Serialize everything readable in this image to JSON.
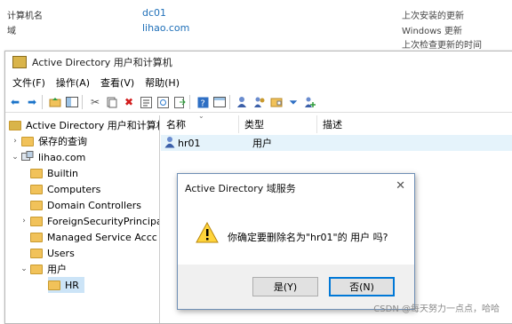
{
  "server_info": {
    "computer_name_label": "计算机名",
    "computer_name_value": "dc01",
    "domain_label": "域",
    "domain_value": "lihao.com",
    "right_line1": "上次安装的更新",
    "right_line2": "Windows 更新",
    "right_line3": "上次检查更新的时间"
  },
  "window": {
    "title": "Active Directory 用户和计算机"
  },
  "menu": [
    "文件(F)",
    "操作(A)",
    "查看(V)",
    "帮助(H)"
  ],
  "toolbar_icons": [
    "back-icon",
    "forward-icon",
    "up-icon",
    "show-tree-icon",
    "cut-icon",
    "copy-icon",
    "delete-icon",
    "properties-icon",
    "refresh-icon",
    "export-icon",
    "help-icon",
    "console-icon",
    "add-user-icon",
    "add-group-icon",
    "add-ou-icon",
    "filter-icon",
    "add-to-group-icon"
  ],
  "tree": {
    "root": "Active Directory 用户和计算机",
    "saved_queries": "保存的查询",
    "domain": "lihao.com",
    "items": [
      "Builtin",
      "Computers",
      "Domain Controllers",
      "ForeignSecurityPrincipa",
      "Managed Service Accc",
      "Users",
      "用户",
      "HR"
    ]
  },
  "list": {
    "columns": [
      "名称",
      "类型",
      "描述"
    ],
    "rows": [
      {
        "name": "hr01",
        "type": "用户",
        "desc": ""
      }
    ]
  },
  "dialog": {
    "title": "Active Directory 域服务",
    "message": "你确定要删除名为\"hr01\"的 用户 吗?",
    "yes_label": "是(Y)",
    "no_label": "否(N)",
    "close": "✕"
  },
  "watermark": "CSDN @每天努力一点点，哈哈"
}
